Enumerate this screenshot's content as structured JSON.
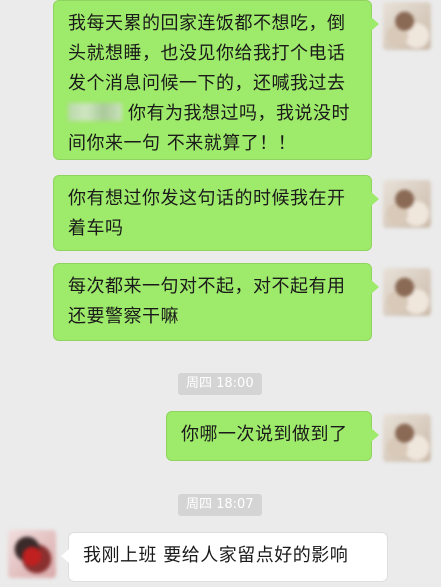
{
  "messages": [
    {
      "side": "out",
      "lines": [
        "我每天累的回家连饭都不想吃，倒",
        "头就想睡，也没见你给我打个电话",
        "发个消息问候一下的，还喊我过去",
        "你有为我想过吗，我说没时",
        "间你来一句   不来就算了！！"
      ]
    },
    {
      "side": "out",
      "lines": [
        "你有想过你发这句话的时候我在开",
        "着车吗"
      ]
    },
    {
      "side": "out",
      "lines": [
        "每次都来一句对不起，对不起有用",
        "还要警察干嘛"
      ]
    },
    {
      "timestamp": "周四 18:00"
    },
    {
      "side": "out",
      "lines": [
        "你哪一次说到做到了"
      ]
    },
    {
      "timestamp": "周四 18:07"
    },
    {
      "side": "in",
      "lines": [
        "我刚上班   要给人家留点好的影响"
      ]
    }
  ],
  "colors": {
    "background": "#ebebeb",
    "outgoing_bubble": "#9eea6a",
    "incoming_bubble": "#ffffff",
    "timestamp_pill": "#d4d4d4"
  },
  "icons": {
    "my_avatar": "avatar-blurred-photo",
    "friend_avatar": "avatar-blurred-photo"
  }
}
